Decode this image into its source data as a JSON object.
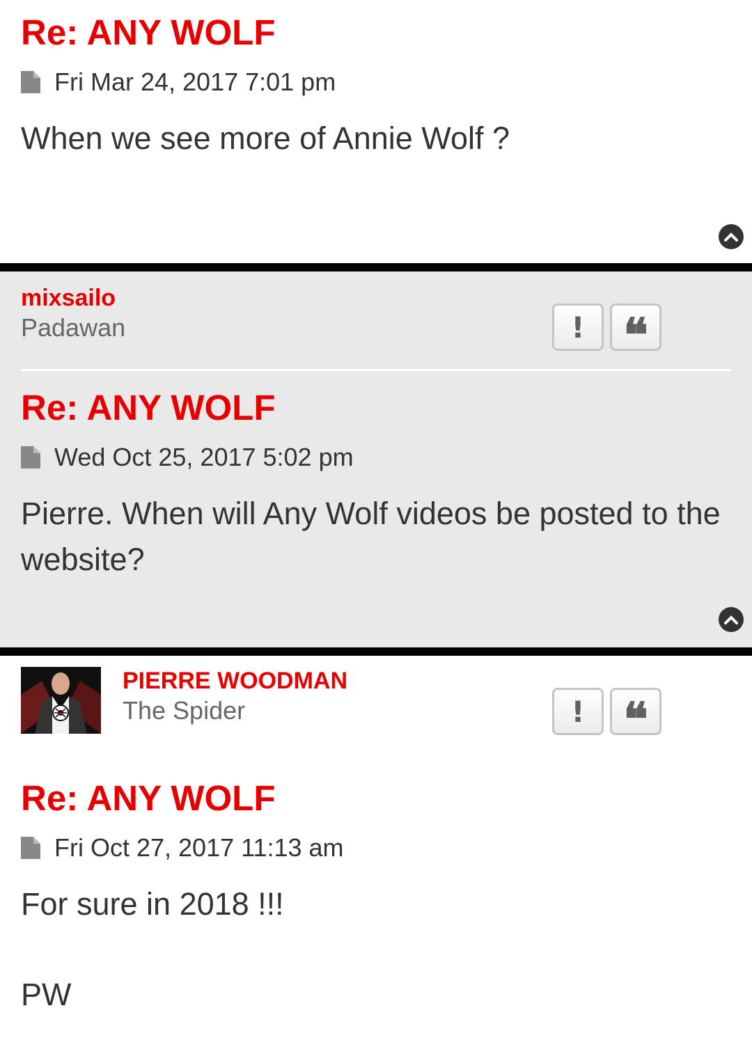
{
  "posts": [
    {
      "title": "Re: ANY WOLF",
      "date": "Fri Mar 24, 2017 7:01 pm",
      "body": "When we see more of Annie Wolf ?"
    },
    {
      "author": "mixsailo",
      "rank": "Padawan",
      "title": "Re: ANY WOLF",
      "date": "Wed Oct 25, 2017 5:02 pm",
      "body": "Pierre. When will Any Wolf videos be posted to the website?"
    },
    {
      "author": "PIERRE WOODMAN",
      "rank": "The Spider",
      "title": "Re: ANY WOLF",
      "date": "Fri Oct 27, 2017 11:13 am",
      "body_line1": "For sure in 2018 !!!",
      "body_line2": "PW"
    }
  ],
  "buttons": {
    "report": "!",
    "quote": "❝"
  },
  "icons": {
    "post_link": "doc-icon",
    "back_to_top": "chevron-up-icon"
  },
  "colors": {
    "accent": "#e60000",
    "alt_background": "#e9e9e9",
    "divider": "#000000"
  }
}
